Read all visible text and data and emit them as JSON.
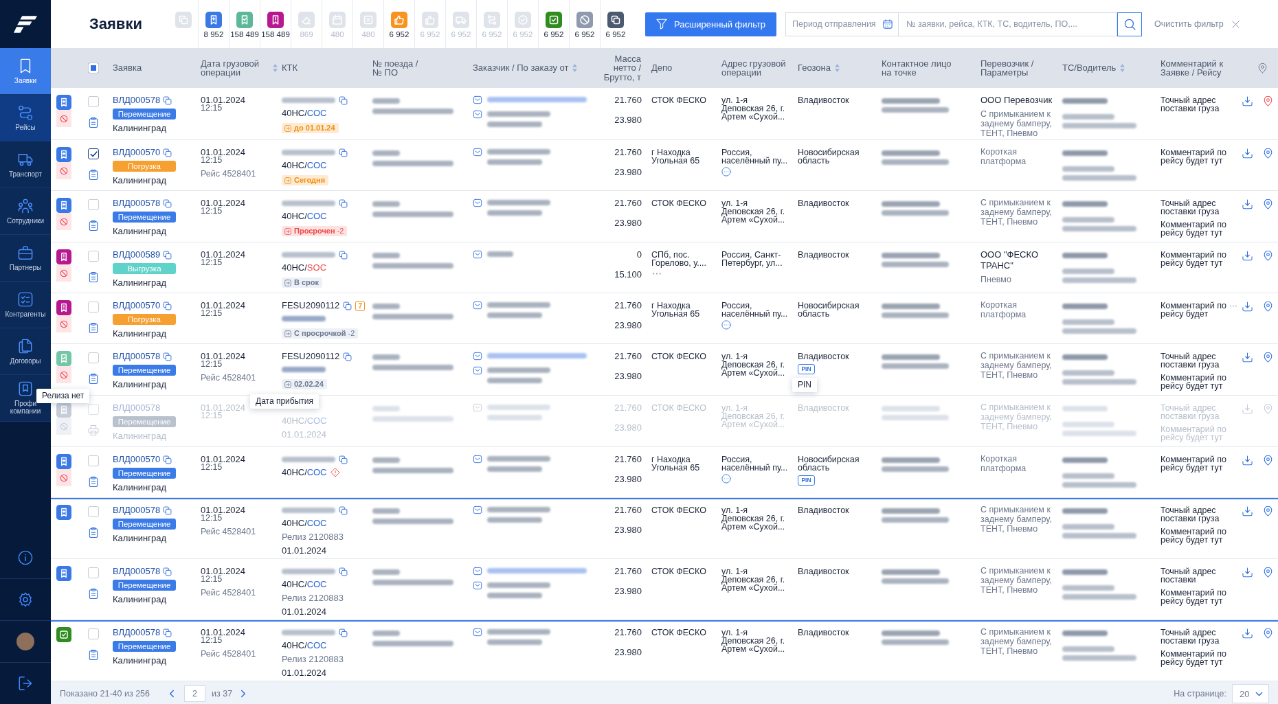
{
  "sidebar": {
    "items": [
      {
        "kind": "bookmark",
        "label": "Заявки",
        "selected": true,
        "highlighted": false
      },
      {
        "kind": "route",
        "label": "Рейсы",
        "selected": false,
        "highlighted": true
      },
      {
        "kind": "truck",
        "label": "Транспорт",
        "selected": false,
        "highlighted": false
      },
      {
        "kind": "people",
        "label": "Сотрудники",
        "selected": false,
        "highlighted": false
      },
      {
        "kind": "briefcase",
        "label": "Партнеры",
        "selected": false,
        "highlighted": false
      },
      {
        "kind": "checklist",
        "label": "Контрагенты",
        "selected": false,
        "highlighted": false
      },
      {
        "kind": "documents",
        "label": "Договоры",
        "selected": false,
        "highlighted": false
      },
      {
        "kind": "profile",
        "label": "Профи компании",
        "selected": false,
        "highlighted": false
      }
    ],
    "bottom": [
      {
        "kind": "info"
      },
      {
        "kind": "settings"
      },
      {
        "kind": "avatar"
      },
      {
        "kind": "logout"
      }
    ]
  },
  "page": {
    "title": "Заявки"
  },
  "status_filters": [
    {
      "kind": "copy",
      "active": false
    },
    {
      "kind": "bookmark-plus",
      "count": "8 952",
      "active": true,
      "color": "#3a78e6"
    },
    {
      "kind": "bookmark-check",
      "count": "158 489",
      "active": true,
      "color": "#5db898"
    },
    {
      "kind": "bookmark-alert",
      "count": "158 489",
      "active": true,
      "color": "#b8188f"
    },
    {
      "kind": "eraser",
      "count": "869",
      "active": false
    },
    {
      "kind": "calendar",
      "count": "480",
      "active": false
    },
    {
      "kind": "x-square",
      "count": "480",
      "active": false
    },
    {
      "kind": "thumbs-up",
      "count": "6 952",
      "active": true,
      "color": "#f7931e"
    },
    {
      "kind": "thumbs-up",
      "count": "6 952",
      "active": false
    },
    {
      "kind": "truck",
      "count": "6 952",
      "active": false
    },
    {
      "kind": "route",
      "count": "6 952",
      "active": false
    },
    {
      "kind": "check-circle",
      "count": "6 952",
      "active": false
    },
    {
      "kind": "check-square",
      "count": "6 952",
      "active": true,
      "color": "#2f8c1f"
    },
    {
      "kind": "no-entry",
      "count": "6 952",
      "active": true,
      "color": "#8f9aae"
    },
    {
      "kind": "copy",
      "count": "6 952",
      "active": true,
      "color": "#4c5a70"
    }
  ],
  "filters": {
    "advanced_button": "Расширенный фильтр",
    "period_placeholder": "Период отправления",
    "search_placeholder": "№ заявки, рейса, КТК, ТС, водитель, ПО,...",
    "clear": "Очистить фильтр"
  },
  "table": {
    "select_all": {
      "indeterminate": true
    },
    "columns": [
      {
        "kind": "text",
        "label": "Заявка",
        "sortable": false
      },
      {
        "kind": "text",
        "label": "Дата грузовой операции",
        "sortable": true
      },
      {
        "kind": "text",
        "label": "КТК",
        "sortable": false
      },
      {
        "kind": "text",
        "label": "№ поезда / № ПО",
        "sortable": false
      },
      {
        "kind": "text",
        "label": "Заказчик / По заказу от",
        "sortable": true
      },
      {
        "kind": "text",
        "label": "Масса нетто / Брутто, т",
        "sortable": false
      },
      {
        "kind": "text",
        "label": "Депо",
        "sortable": false
      },
      {
        "kind": "text",
        "label": "Адрес грузовой операции",
        "sortable": false
      },
      {
        "kind": "text",
        "label": "Геозона",
        "sortable": true
      },
      {
        "kind": "text",
        "label": "Контактное лицо на точке",
        "sortable": false
      },
      {
        "kind": "text",
        "label": "Перевозчик / Параметры",
        "sortable": false
      },
      {
        "kind": "text",
        "label": "ТС/Водитель",
        "sortable": true
      },
      {
        "kind": "text",
        "label": "Комментарий к Заявке / Рейсу",
        "sortable": false
      },
      {
        "kind": "icon"
      }
    ],
    "rows": [
      {
        "status": {
          "kind": "bookmark-plus",
          "color": "#3a78e6"
        },
        "no_release": true,
        "checked": false,
        "disabled": false,
        "group_start": false,
        "document": {
          "kind": "clipboard"
        },
        "request": {
          "id": "ВЛД000578",
          "operation": {
            "label": "Перемещение",
            "color": "#3b7be8"
          },
          "city": "Калининград"
        },
        "date": "01.01.2024",
        "time": "12:15",
        "ktk": {
          "number_redacted": true,
          "type_redacted": false,
          "type": "40НС/",
          "owner": "СОС",
          "owner_alert": false,
          "warning": false,
          "deadline": {
            "kind": "warning",
            "label": "до 01.01.24"
          }
        },
        "customers": [
          {
            "kind": "link"
          },
          {
            "kind": "name"
          }
        ],
        "net": "21.760",
        "gross": "23.980",
        "depot": {
          "text": "СТОК ФЕСКО",
          "more": false
        },
        "address": {
          "text": "ул. 1-я Деповская 26, г. Артем «Сухой...",
          "more": false
        },
        "geozone": {
          "text": "Владивосток"
        },
        "carrier": {
          "name": "ООО Перевозчик",
          "params": "С примыканием к заднему бамперу, ТЕНТ, Пневмо"
        },
        "comments": [
          {
            "text": "Точный адрес поставки груза",
            "more": false
          }
        ],
        "pin_alert": true
      },
      {
        "status": {
          "kind": "bookmark-plus",
          "color": "#3a78e6"
        },
        "no_release": true,
        "checked": true,
        "disabled": false,
        "group_start": false,
        "document": {
          "kind": "clipboard"
        },
        "request": {
          "id": "ВЛД000570",
          "operation": {
            "label": "Погрузка",
            "color": "#f7a032"
          },
          "city": "Калининград"
        },
        "date": "01.01.2024",
        "time": "12:15",
        "trip": "Рейс 4528401",
        "ktk": {
          "number_redacted": true,
          "type_redacted": false,
          "type": "40НС/",
          "owner": "СОС",
          "owner_alert": false,
          "warning": false,
          "deadline": {
            "kind": "warning",
            "label": "Сегодня"
          }
        },
        "customers": [
          {
            "kind": "name"
          }
        ],
        "net": "21.760",
        "gross": "23.980",
        "depot": {
          "text": "г Находка Угольная 65",
          "more": false
        },
        "address": {
          "text": "Россия, населённый пу...",
          "more": true
        },
        "geozone": {
          "text": "Новосибирская область"
        },
        "carrier": {
          "params": "Короткая платформа"
        },
        "comments": [
          {
            "text": "Комментарий по рейсу будет тут",
            "more": false
          }
        ],
        "pin_alert": false
      },
      {
        "status": {
          "kind": "bookmark-plus",
          "color": "#3a78e6"
        },
        "no_release": true,
        "checked": false,
        "disabled": false,
        "group_start": false,
        "document": {
          "kind": "clipboard"
        },
        "request": {
          "id": "ВЛД000578",
          "operation": {
            "label": "Перемещение",
            "color": "#3b7be8"
          },
          "city": "Калининград"
        },
        "date": "01.01.2024",
        "time": "12:15",
        "ktk": {
          "number_redacted": true,
          "type_redacted": false,
          "type": "40НС/",
          "owner": "СОС",
          "owner_alert": false,
          "warning": false,
          "deadline": {
            "kind": "danger",
            "label": "Просрочен",
            "delta": "-2"
          }
        },
        "customers": [
          {
            "kind": "name"
          }
        ],
        "net": "21.760",
        "gross": "23.980",
        "depot": {
          "text": "СТОК ФЕСКО",
          "more": false
        },
        "address": {
          "text": "ул. 1-я Деповская 26, г. Артем «Сухой...",
          "more": false
        },
        "geozone": {
          "text": "Владивосток"
        },
        "carrier": {
          "params": "С примыканием к заднему бамперу, ТЕНТ, Пневмо"
        },
        "comments": [
          {
            "text": "Точный адрес поставки груза",
            "more": false
          },
          {
            "text": "Комментарий по рейсу будет тут",
            "more": false
          }
        ],
        "pin_alert": false
      },
      {
        "status": {
          "kind": "bookmark-alert",
          "color": "#b8188f"
        },
        "no_release": true,
        "checked": false,
        "disabled": false,
        "group_start": false,
        "document": {
          "kind": "clipboard"
        },
        "request": {
          "id": "ВЛД000589",
          "operation": {
            "label": "Выгрузка",
            "color": "#5fd3c9"
          },
          "city": "Калининград"
        },
        "date": "01.01.2024",
        "time": "12:15",
        "ktk": {
          "number_redacted": true,
          "type_redacted": false,
          "type": "40НС/",
          "owner": "SOC",
          "owner_alert": true,
          "warning": false,
          "deadline": {
            "kind": "neutral",
            "label": "В срок"
          }
        },
        "customers": [
          {
            "kind": "short"
          }
        ],
        "net": "0",
        "gross": "15.100",
        "depot": {
          "text": "СПб, пос. Горелово, у....",
          "more": true
        },
        "address": {
          "text": "Россия, Санкт-Петербург, ул...",
          "more": false
        },
        "geozone": {
          "text": "Владивосток"
        },
        "carrier": {
          "name": "ООО \"ФЕСКО ТРАНС\"",
          "params": "Пневмо"
        },
        "comments": [
          {
            "text": "Комментарий по рейсу будет тут",
            "more": false
          }
        ],
        "pin_alert": false
      },
      {
        "status": {
          "kind": "bookmark-alert",
          "color": "#b8188f"
        },
        "no_release": true,
        "checked": false,
        "disabled": false,
        "group_start": false,
        "document": {
          "kind": "clipboard"
        },
        "request": {
          "id": "ВЛД000570",
          "operation": {
            "label": "Погрузка",
            "color": "#f7a032"
          },
          "city": "Калининград"
        },
        "date": "01.01.2024",
        "time": "12:15",
        "ktk": {
          "number": "FESU2090112",
          "number_redacted": false,
          "count": "7",
          "type_redacted": true,
          "warning": false,
          "deadline": {
            "kind": "neutral",
            "label": "С просрочкой",
            "delta": "-2"
          }
        },
        "customers": [
          {
            "kind": "name"
          }
        ],
        "net": "21.760",
        "gross": "23.980",
        "depot": {
          "text": "г Находка Угольная 65",
          "more": false
        },
        "address": {
          "text": "Россия, населённый пу...",
          "more": true
        },
        "geozone": {
          "text": "Новосибирская область"
        },
        "carrier": {
          "params": "Короткая платформа"
        },
        "comments": [
          {
            "text": "Комментарий по рейсу будет",
            "more": true
          }
        ],
        "pin_alert": false
      },
      {
        "status": {
          "kind": "bookmark-check",
          "color": "#74c6a8"
        },
        "no_release": true,
        "no_release_tooltip": "Релиза нет",
        "checked": false,
        "disabled": false,
        "group_start": false,
        "document": {
          "kind": "clipboard"
        },
        "request": {
          "id": "ВЛД000578",
          "operation": {
            "label": "Перемещение",
            "color": "#3b7be8"
          },
          "city": "Калининград"
        },
        "date": "01.01.2024",
        "time": "12:15",
        "trip": "Рейс 4528401",
        "ktk": {
          "number": "FESU2090112",
          "number_redacted": false,
          "type_redacted": true,
          "warning": false,
          "deadline": {
            "kind": "neutral",
            "label": "02.02.24",
            "tooltip": "Дата прибытия"
          }
        },
        "customers": [
          {
            "kind": "link"
          },
          {
            "kind": "name"
          }
        ],
        "net": "21.760",
        "gross": "23.980",
        "depot": {
          "text": "СТОК ФЕСКО",
          "more": false
        },
        "address": {
          "text": "ул. 1-я Деповская 26, г. Артем «Сухой...",
          "more": false
        },
        "geozone": {
          "text": "Владивосток",
          "pin": {
            "label": "PIN",
            "tooltip": "PIN"
          }
        },
        "carrier": {
          "params": "С примыканием к заднему бамперу, ТЕНТ, Пневмо"
        },
        "comments": [
          {
            "text": "Точный адрес поставки груза",
            "more": false
          },
          {
            "text": "Комментарий по рейсу будет тут",
            "more": false
          }
        ],
        "pin_alert": false
      },
      {
        "status": {
          "kind": "bookmark-plus",
          "color": "#c5ccd8"
        },
        "no_release": true,
        "checked": false,
        "disabled": true,
        "group_start": false,
        "document": {
          "kind": "printer"
        },
        "request": {
          "id": "ВЛД000578",
          "operation": {
            "label": "Перемещение",
            "color": "#b9c1ce"
          },
          "city": "Калининград"
        },
        "date": "01.01.2024",
        "time": "12:15",
        "ktk": {
          "number_redacted": false,
          "type_redacted": false,
          "type": "40НС/",
          "owner": "СОС",
          "owner_alert": false,
          "warning": false,
          "release_date": "01.01.2024"
        },
        "customers": [
          {
            "kind": "name"
          }
        ],
        "net": "21.760",
        "gross": "23.980",
        "depot": {
          "text": "СТОК ФЕСКО",
          "more": false
        },
        "address": {
          "text": "ул. 1-я Деповская 26, г. Артем «Сухой...",
          "more": false
        },
        "geozone": {
          "text": "Владивосток"
        },
        "carrier": {
          "params": "С примыканием к заднему бамперу, ТЕНТ, Пневмо"
        },
        "comments": [
          {
            "text": "Точный адрес поставки груза",
            "more": false
          },
          {
            "text": "Комментарий по рейсу будет тут",
            "more": false
          }
        ],
        "pin_alert": false
      },
      {
        "status": {
          "kind": "bookmark-plus",
          "color": "#3a78e6"
        },
        "no_release": true,
        "checked": false,
        "disabled": false,
        "group_start": false,
        "document": {
          "kind": "clipboard"
        },
        "request": {
          "id": "ВЛД000570",
          "operation": {
            "label": "Перемещение",
            "color": "#3b7be8"
          },
          "city": "Калининград"
        },
        "date": "01.01.2024",
        "time": "12:15",
        "ktk": {
          "number_redacted": true,
          "type_redacted": false,
          "type": "40НС/",
          "owner": "СОС",
          "owner_alert": false,
          "warning": true
        },
        "customers": [
          {
            "kind": "name"
          }
        ],
        "net": "21.760",
        "gross": "23.980",
        "depot": {
          "text": "г Находка Угольная 65",
          "more": false
        },
        "address": {
          "text": "Россия, населённый пу...",
          "more": true
        },
        "geozone": {
          "text": "Новосибирская область",
          "pin": {
            "label": "PIN"
          }
        },
        "carrier": {
          "params": "Короткая платформа"
        },
        "comments": [
          {
            "text": "Комментарий по рейсу будет тут",
            "more": false
          }
        ],
        "pin_alert": false
      },
      {
        "status": {
          "kind": "bookmark-plus",
          "color": "#3a78e6"
        },
        "no_release": false,
        "checked": false,
        "disabled": false,
        "group_start": true,
        "document": {
          "kind": "clipboard"
        },
        "request": {
          "id": "ВЛД000578",
          "operation": {
            "label": "Перемещение",
            "color": "#3b7be8"
          },
          "city": "Калининград"
        },
        "date": "01.01.2024",
        "time": "12:15",
        "trip": "Рейс 4528401",
        "ktk": {
          "number_redacted": true,
          "type_redacted": false,
          "type": "40НС/",
          "owner": "СОС",
          "owner_alert": false,
          "warning": false,
          "release": "Релиз 2120883",
          "release_date": "01.01.2024"
        },
        "customers": [
          {
            "kind": "name"
          }
        ],
        "net": "21.760",
        "gross": "23.980",
        "depot": {
          "text": "СТОК ФЕСКО",
          "more": false
        },
        "address": {
          "text": "ул. 1-я Деповская 26, г. Артем «Сухой...",
          "more": false
        },
        "geozone": {
          "text": "Владивосток"
        },
        "carrier": {
          "params": "С примыканием к заднему бамперу, ТЕНТ, Пневмо"
        },
        "comments": [
          {
            "text": "Точный адрес поставки груза",
            "more": false
          },
          {
            "text": "Комментарий по рейсу будет тут",
            "more": false
          }
        ],
        "pin_alert": false
      },
      {
        "status": {
          "kind": "bookmark-plus",
          "color": "#3a78e6"
        },
        "no_release": false,
        "checked": false,
        "disabled": false,
        "group_start": false,
        "document": {
          "kind": "clipboard"
        },
        "request": {
          "id": "ВЛД000578",
          "operation": {
            "label": "Перемещение",
            "color": "#3b7be8"
          },
          "city": "Калининград"
        },
        "date": "01.01.2024",
        "time": "12:15",
        "trip": "Рейс 4528401",
        "ktk": {
          "number_redacted": true,
          "type_redacted": false,
          "type": "40НС/",
          "owner": "СОС",
          "owner_alert": false,
          "warning": false,
          "release": "Релиз 2120883",
          "release_date": "01.01.2024"
        },
        "customers": [
          {
            "kind": "link"
          },
          {
            "kind": "name"
          }
        ],
        "net": "21.760",
        "gross": "23.980",
        "depot": {
          "text": "СТОК ФЕСКО",
          "more": false
        },
        "address": {
          "text": "ул. 1-я Деповская 26, г. Артем «Сухой...",
          "more": false
        },
        "geozone": {
          "text": "Владивосток"
        },
        "carrier": {
          "params": "С примыканием к заднему бамперу, ТЕНТ, Пневмо"
        },
        "comments": [
          {
            "text": "Точный адрес поставки",
            "more": false
          },
          {
            "text": "Комментарий по рейсу будет тут",
            "more": false
          }
        ],
        "pin_alert": false
      },
      {
        "status": {
          "kind": "check-square",
          "color": "#2f8c1f"
        },
        "no_release": false,
        "checked": false,
        "disabled": false,
        "group_start": true,
        "document": {
          "kind": "clipboard"
        },
        "request": {
          "id": "ВЛД000578",
          "operation": {
            "label": "Перемещение",
            "color": "#3b7be8"
          },
          "city": "Калининград"
        },
        "date": "01.01.2024",
        "time": "12:15",
        "trip": "Рейс 4528401",
        "ktk": {
          "number_redacted": true,
          "type_redacted": false,
          "type": "40НС/",
          "owner": "СОС",
          "owner_alert": false,
          "warning": false,
          "release": "Релиз 2120883",
          "release_date": "01.01.2024"
        },
        "customers": [
          {
            "kind": "name"
          }
        ],
        "net": "21.760",
        "gross": "23.980",
        "depot": {
          "text": "СТОК ФЕСКО",
          "more": false
        },
        "address": {
          "text": "ул. 1-я Деповская 26, г. Артем «Сухой...",
          "more": false
        },
        "geozone": {
          "text": "Владивосток"
        },
        "carrier": {
          "params": "С примыканием к заднему бамперу, ТЕНТ, Пневмо"
        },
        "comments": [
          {
            "text": "Точный адрес поставки груза",
            "more": false
          },
          {
            "text": "Комментарий по рейсу будет тут",
            "more": false
          }
        ],
        "pin_alert": false
      }
    ]
  },
  "footer": {
    "shown": "Показано 21-40 из 256",
    "page": "2",
    "of": "из 37",
    "per_page_label": "На странице:",
    "per_page": "20"
  }
}
